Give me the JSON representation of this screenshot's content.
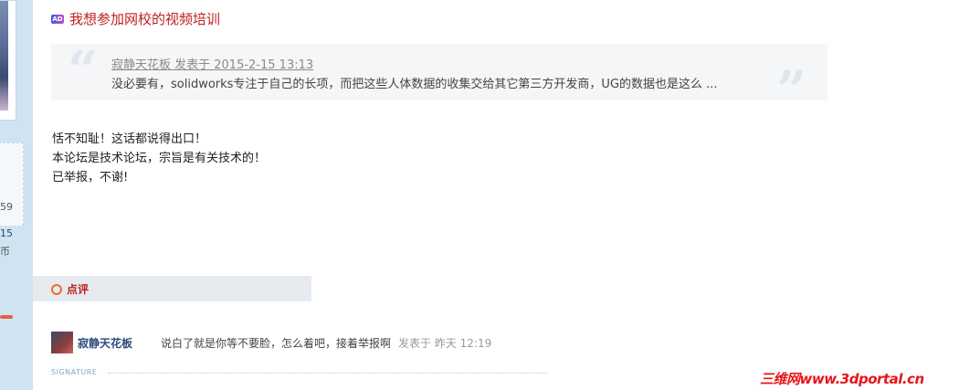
{
  "sidebar": {
    "stat_1": "59",
    "stat_2": "15",
    "stat_3": "币"
  },
  "post_title": {
    "ad_badge": "AD",
    "text": "我想参加网校的视频培训"
  },
  "quote": {
    "meta": "寂静天花板 发表于 2015-2-15 13:13",
    "body": "没必要有，solidworks专注于自己的长项，而把这些人体数据的收集交给其它第三方开发商，UG的数据也是这么 ..."
  },
  "content": {
    "lines": [
      "恬不知耻！这话都说得出口！",
      "本论坛是技术论坛，宗旨是有关技术的！",
      "已举报，不谢!"
    ]
  },
  "comments_section": {
    "title": "点评",
    "items": [
      {
        "user": "寂静天花板",
        "text": "说白了就是你等不要脸，怎么着吧，接着举报啊",
        "time": "发表于 昨天 12:19"
      }
    ]
  },
  "signature_label": "SIGNATURE",
  "watermark": "三维网www.3dportal.cn",
  "colors": {
    "title": "#c01e1e",
    "sidebar": "#cfe3f1",
    "watermark": "#e8141b",
    "username": "#2b4a78"
  }
}
